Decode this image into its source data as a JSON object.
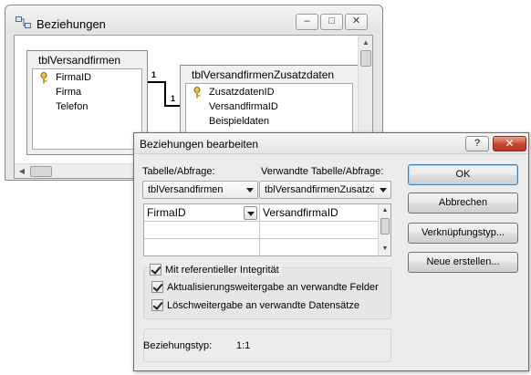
{
  "relations_window": {
    "title": "Beziehungen",
    "min_label": "–",
    "max_label": "□",
    "close_label": "✕",
    "tables": [
      {
        "name": "tblVersandfirmen",
        "fields": [
          "FirmaID",
          "Firma",
          "Telefon"
        ]
      },
      {
        "name": "tblVersandfirmenZusatzdaten",
        "fields": [
          "ZusatzdatenID",
          "VersandfirmaID",
          "Beispieldaten"
        ]
      }
    ],
    "relation": {
      "left_label": "1",
      "right_label": "1"
    },
    "scroll": {
      "up": "▲",
      "down": "▼",
      "left": "◀",
      "right": "▶"
    }
  },
  "dialog": {
    "title": "Beziehungen bearbeiten",
    "help_label": "?",
    "close_label": "✕",
    "table_label": "Tabelle/Abfrage:",
    "related_label": "Verwandte Tabelle/Abfrage:",
    "table_value": "tblVersandfirmen",
    "related_value": "tblVersandfirmenZusatzdaten",
    "grid": {
      "left_field": "FirmaID",
      "right_field": "VersandfirmaID"
    },
    "checkboxes": {
      "integrity": "Mit referentieller Integrität",
      "cascade_update": "Aktualisierungsweitergabe an verwandte Felder",
      "cascade_delete": "Löschweitergabe an verwandte Datensätze"
    },
    "checked": {
      "integrity": true,
      "cascade_update": true,
      "cascade_delete": true
    },
    "type_label": "Beziehungstyp:",
    "type_value": "1:1",
    "buttons": {
      "ok": "OK",
      "cancel": "Abbrechen",
      "join_type": "Verknüpfungstyp...",
      "create_new": "Neue erstellen..."
    },
    "grid_scroll": {
      "up": "▲",
      "down": "▼"
    }
  },
  "colors": {
    "close_button": "#c6452f",
    "default_button_border": "#3c7fb1"
  }
}
